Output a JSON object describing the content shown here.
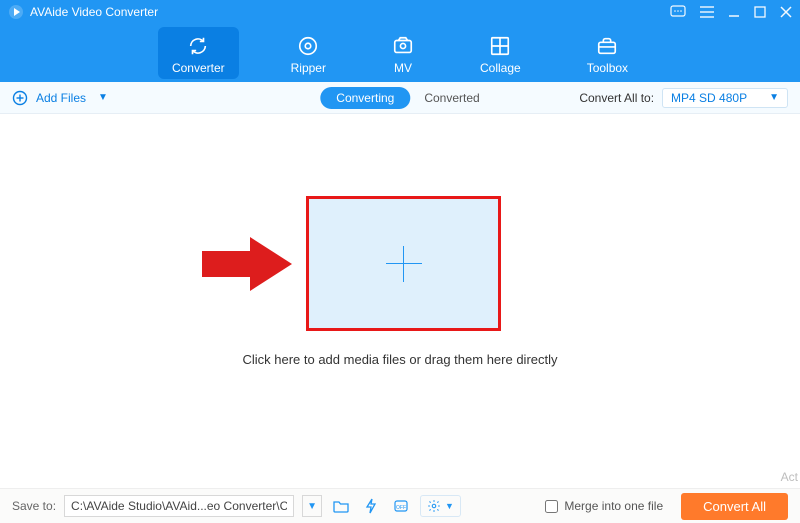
{
  "app": {
    "title": "AVAide Video Converter"
  },
  "nav": {
    "converter": "Converter",
    "ripper": "Ripper",
    "mv": "MV",
    "collage": "Collage",
    "toolbox": "Toolbox"
  },
  "actionbar": {
    "add_files": "Add Files",
    "tab_converting": "Converting",
    "tab_converted": "Converted",
    "convert_all_to": "Convert All to:",
    "output_format": "MP4 SD 480P"
  },
  "main": {
    "hint": "Click here to add media files or drag them here directly",
    "watermark": "Act"
  },
  "footer": {
    "save_to_label": "Save to:",
    "save_path": "C:\\AVAide Studio\\AVAid...eo Converter\\Converted",
    "merge_label": "Merge into one file",
    "merge_checked": false,
    "convert_all": "Convert All"
  },
  "colors": {
    "primary": "#2196f3",
    "accent": "#ff7a2b",
    "highlight_border": "#e81818",
    "arrow_fill": "#dd1d1d"
  }
}
